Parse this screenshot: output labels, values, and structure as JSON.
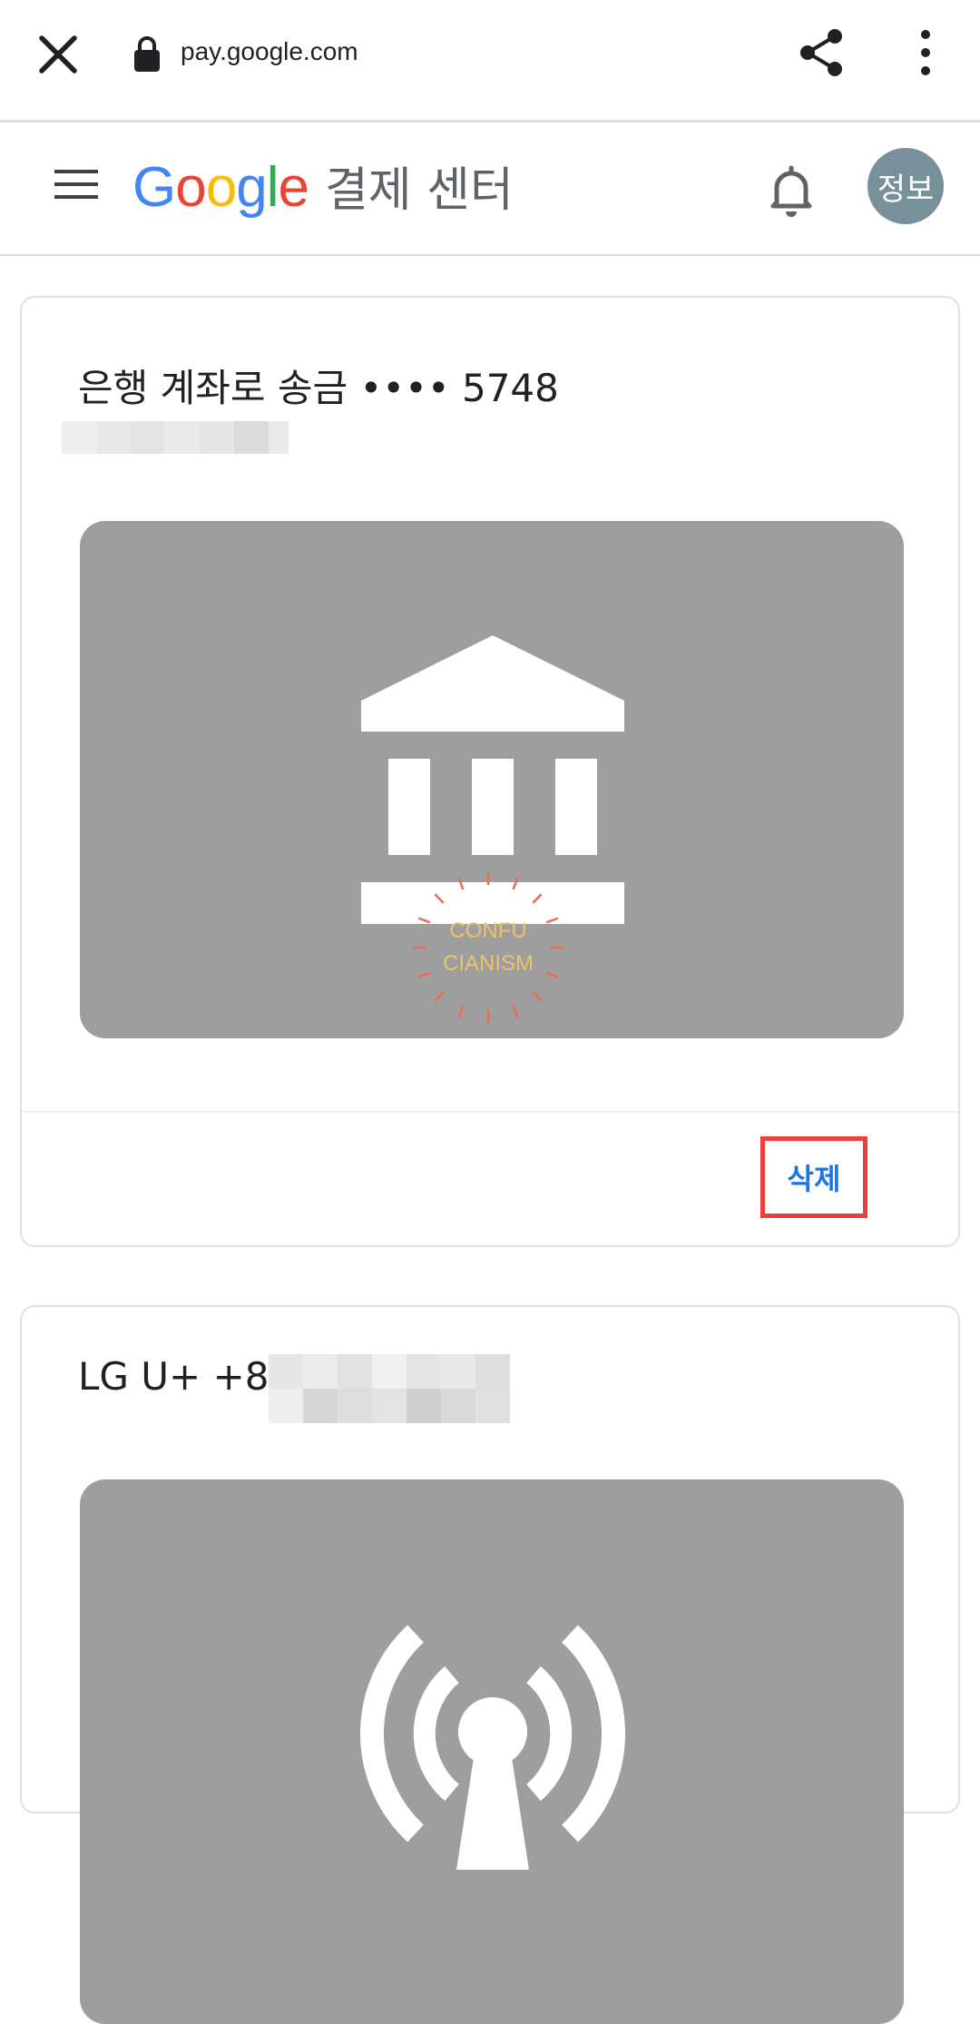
{
  "browser": {
    "url": "pay.google.com",
    "icons": [
      "close-icon",
      "lock-icon",
      "share-icon",
      "more-vert-icon"
    ]
  },
  "header": {
    "logo_letters": [
      {
        "char": "G",
        "color": "#4285F4"
      },
      {
        "char": "o",
        "color": "#EA4335"
      },
      {
        "char": "o",
        "color": "#FBBC05"
      },
      {
        "char": "g",
        "color": "#4285F4"
      },
      {
        "char": "l",
        "color": "#34A853"
      },
      {
        "char": "e",
        "color": "#EA4335"
      }
    ],
    "title": "결제 센터",
    "avatar_label": "정보",
    "icons": [
      "menu-icon",
      "bell-icon"
    ]
  },
  "cards": [
    {
      "title": "은행 계좌로 송금 •••• 5748",
      "image_icon": "bank-icon",
      "watermark_line1": "CONFU",
      "watermark_line2": "CIANISM",
      "delete_label": "삭제"
    },
    {
      "title": "LG U+ +82",
      "image_icon": "signal-icon"
    }
  ],
  "colors": {
    "accent_blue": "#1a73e8",
    "highlight_red": "#e8413b",
    "image_gray": "#9e9e9e",
    "avatar_gray": "#78909c"
  }
}
